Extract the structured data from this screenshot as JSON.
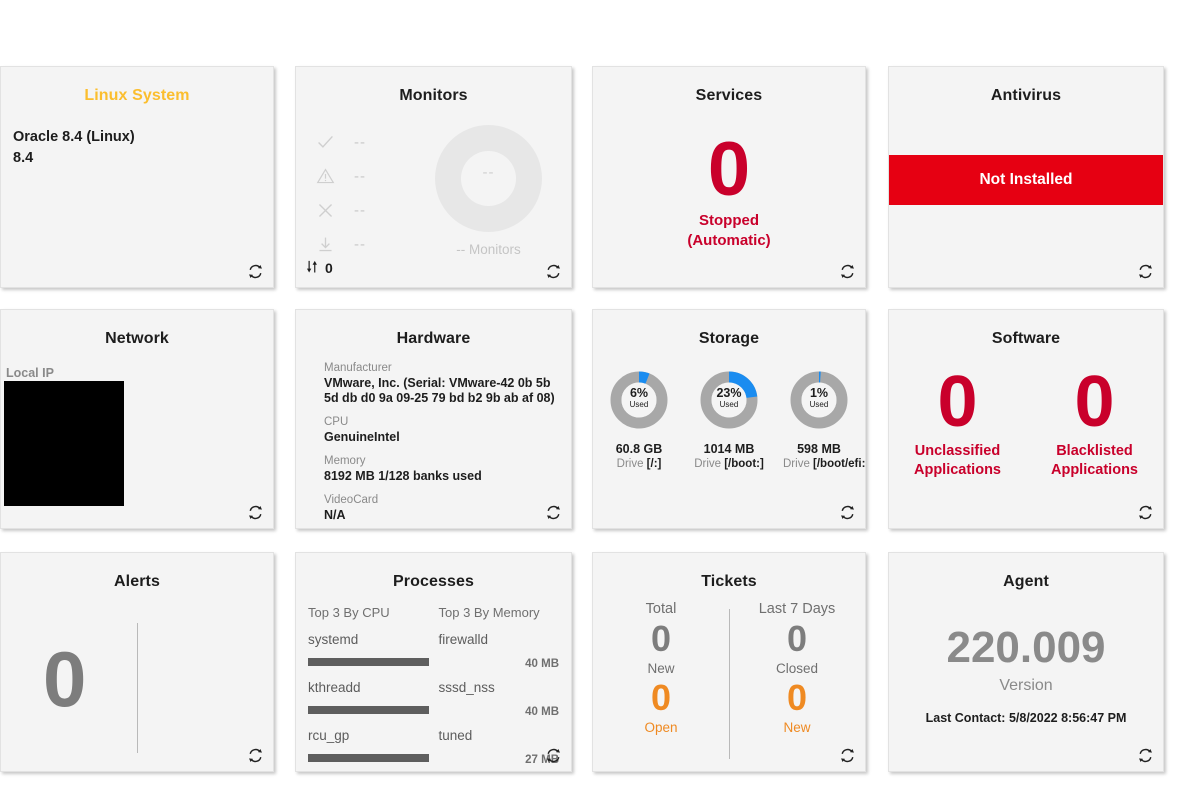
{
  "cards": {
    "system": {
      "title": "Linux System",
      "os": "Oracle 8.4 (Linux)",
      "version": "8.4",
      "title_color": "#fbbe2e",
      "refresh_icon": "refresh-icon"
    },
    "monitors": {
      "title": "Monitors",
      "stats": [
        {
          "icon": "check-icon",
          "value": "--"
        },
        {
          "icon": "warning-triangle-icon",
          "value": "--"
        },
        {
          "icon": "close-x-icon",
          "value": "--"
        },
        {
          "icon": "download-icon",
          "value": "--"
        }
      ],
      "donut_center": "--",
      "donut_caption": "-- Monitors",
      "transfer_icon": "transfer-arrows-icon",
      "transfer_value": "0",
      "refresh_icon": "refresh-icon"
    },
    "services": {
      "title": "Services",
      "count": "0",
      "status_line1": "Stopped",
      "status_line2": "(Automatic)",
      "status_color": "#c9002b",
      "refresh_icon": "refresh-icon"
    },
    "antivirus": {
      "title": "Antivirus",
      "status": "Not Installed",
      "status_bg": "#e60012",
      "refresh_icon": "refresh-icon"
    },
    "network": {
      "title": "Network",
      "local_ip_label": "Local IP",
      "local_ip_value": "",
      "redacted": true,
      "refresh_icon": "refresh-icon"
    },
    "hardware": {
      "title": "Hardware",
      "fields": [
        {
          "key": "Manufacturer",
          "value": "VMware, Inc. (Serial: VMware-42 0b 5b 5d db d0 9a 09-25 79 bd b2 9b ab af 08)"
        },
        {
          "key": "CPU",
          "value": "GenuineIntel"
        },
        {
          "key": "Memory",
          "value": "8192 MB 1/128 banks used"
        },
        {
          "key": "VideoCard",
          "value": "N/A"
        }
      ],
      "refresh_icon": "refresh-icon"
    },
    "storage": {
      "title": "Storage",
      "used_label": "Used",
      "drives": [
        {
          "percent": 6,
          "percent_label": "6%",
          "size": "60.8 GB",
          "drive_prefix": "Drive ",
          "drive_name": "[/:]"
        },
        {
          "percent": 23,
          "percent_label": "23%",
          "size": "1014 MB",
          "drive_prefix": "Drive ",
          "drive_name": "[/boot:]"
        },
        {
          "percent": 1,
          "percent_label": "1%",
          "size": "598 MB",
          "drive_prefix": "Drive ",
          "drive_name": "[/boot/efi:]"
        }
      ],
      "arc_color": "#1a8cf0",
      "track_color": "#a8a8a8",
      "refresh_icon": "refresh-icon"
    },
    "software": {
      "title": "Software",
      "items": [
        {
          "count": "0",
          "label_line1": "Unclassified",
          "label_line2": "Applications"
        },
        {
          "count": "0",
          "label_line1": "Blacklisted",
          "label_line2": "Applications"
        }
      ],
      "accent_color": "#c9002b",
      "refresh_icon": "refresh-icon"
    },
    "alerts": {
      "title": "Alerts",
      "count": "0",
      "refresh_icon": "refresh-icon"
    },
    "processes": {
      "title": "Processes",
      "cpu_header": "Top 3 By CPU",
      "memory_header": "Top 3 By Memory",
      "cpu": [
        {
          "name": "systemd",
          "bar_percent": 100
        },
        {
          "name": "kthreadd",
          "bar_percent": 100
        },
        {
          "name": "rcu_gp",
          "bar_percent": 100
        }
      ],
      "memory": [
        {
          "name": "firewalld",
          "value": "40 MB"
        },
        {
          "name": "sssd_nss",
          "value": "40 MB"
        },
        {
          "name": "tuned",
          "value": "27 MB"
        }
      ],
      "refresh_icon": "refresh-icon"
    },
    "tickets": {
      "title": "Tickets",
      "left": {
        "header": "Total",
        "top_num": "0",
        "top_label": "New",
        "bottom_num": "0",
        "bottom_label": "Open"
      },
      "right": {
        "header": "Last 7 Days",
        "top_num": "0",
        "top_label": "Closed",
        "bottom_num": "0",
        "bottom_label": "New"
      },
      "accent_color": "#ef8a22",
      "refresh_icon": "refresh-icon"
    },
    "agent": {
      "title": "Agent",
      "version": "220.009",
      "version_label": "Version",
      "last_contact": "Last Contact: 5/8/2022 8:56:47 PM",
      "refresh_icon": "refresh-icon"
    }
  }
}
